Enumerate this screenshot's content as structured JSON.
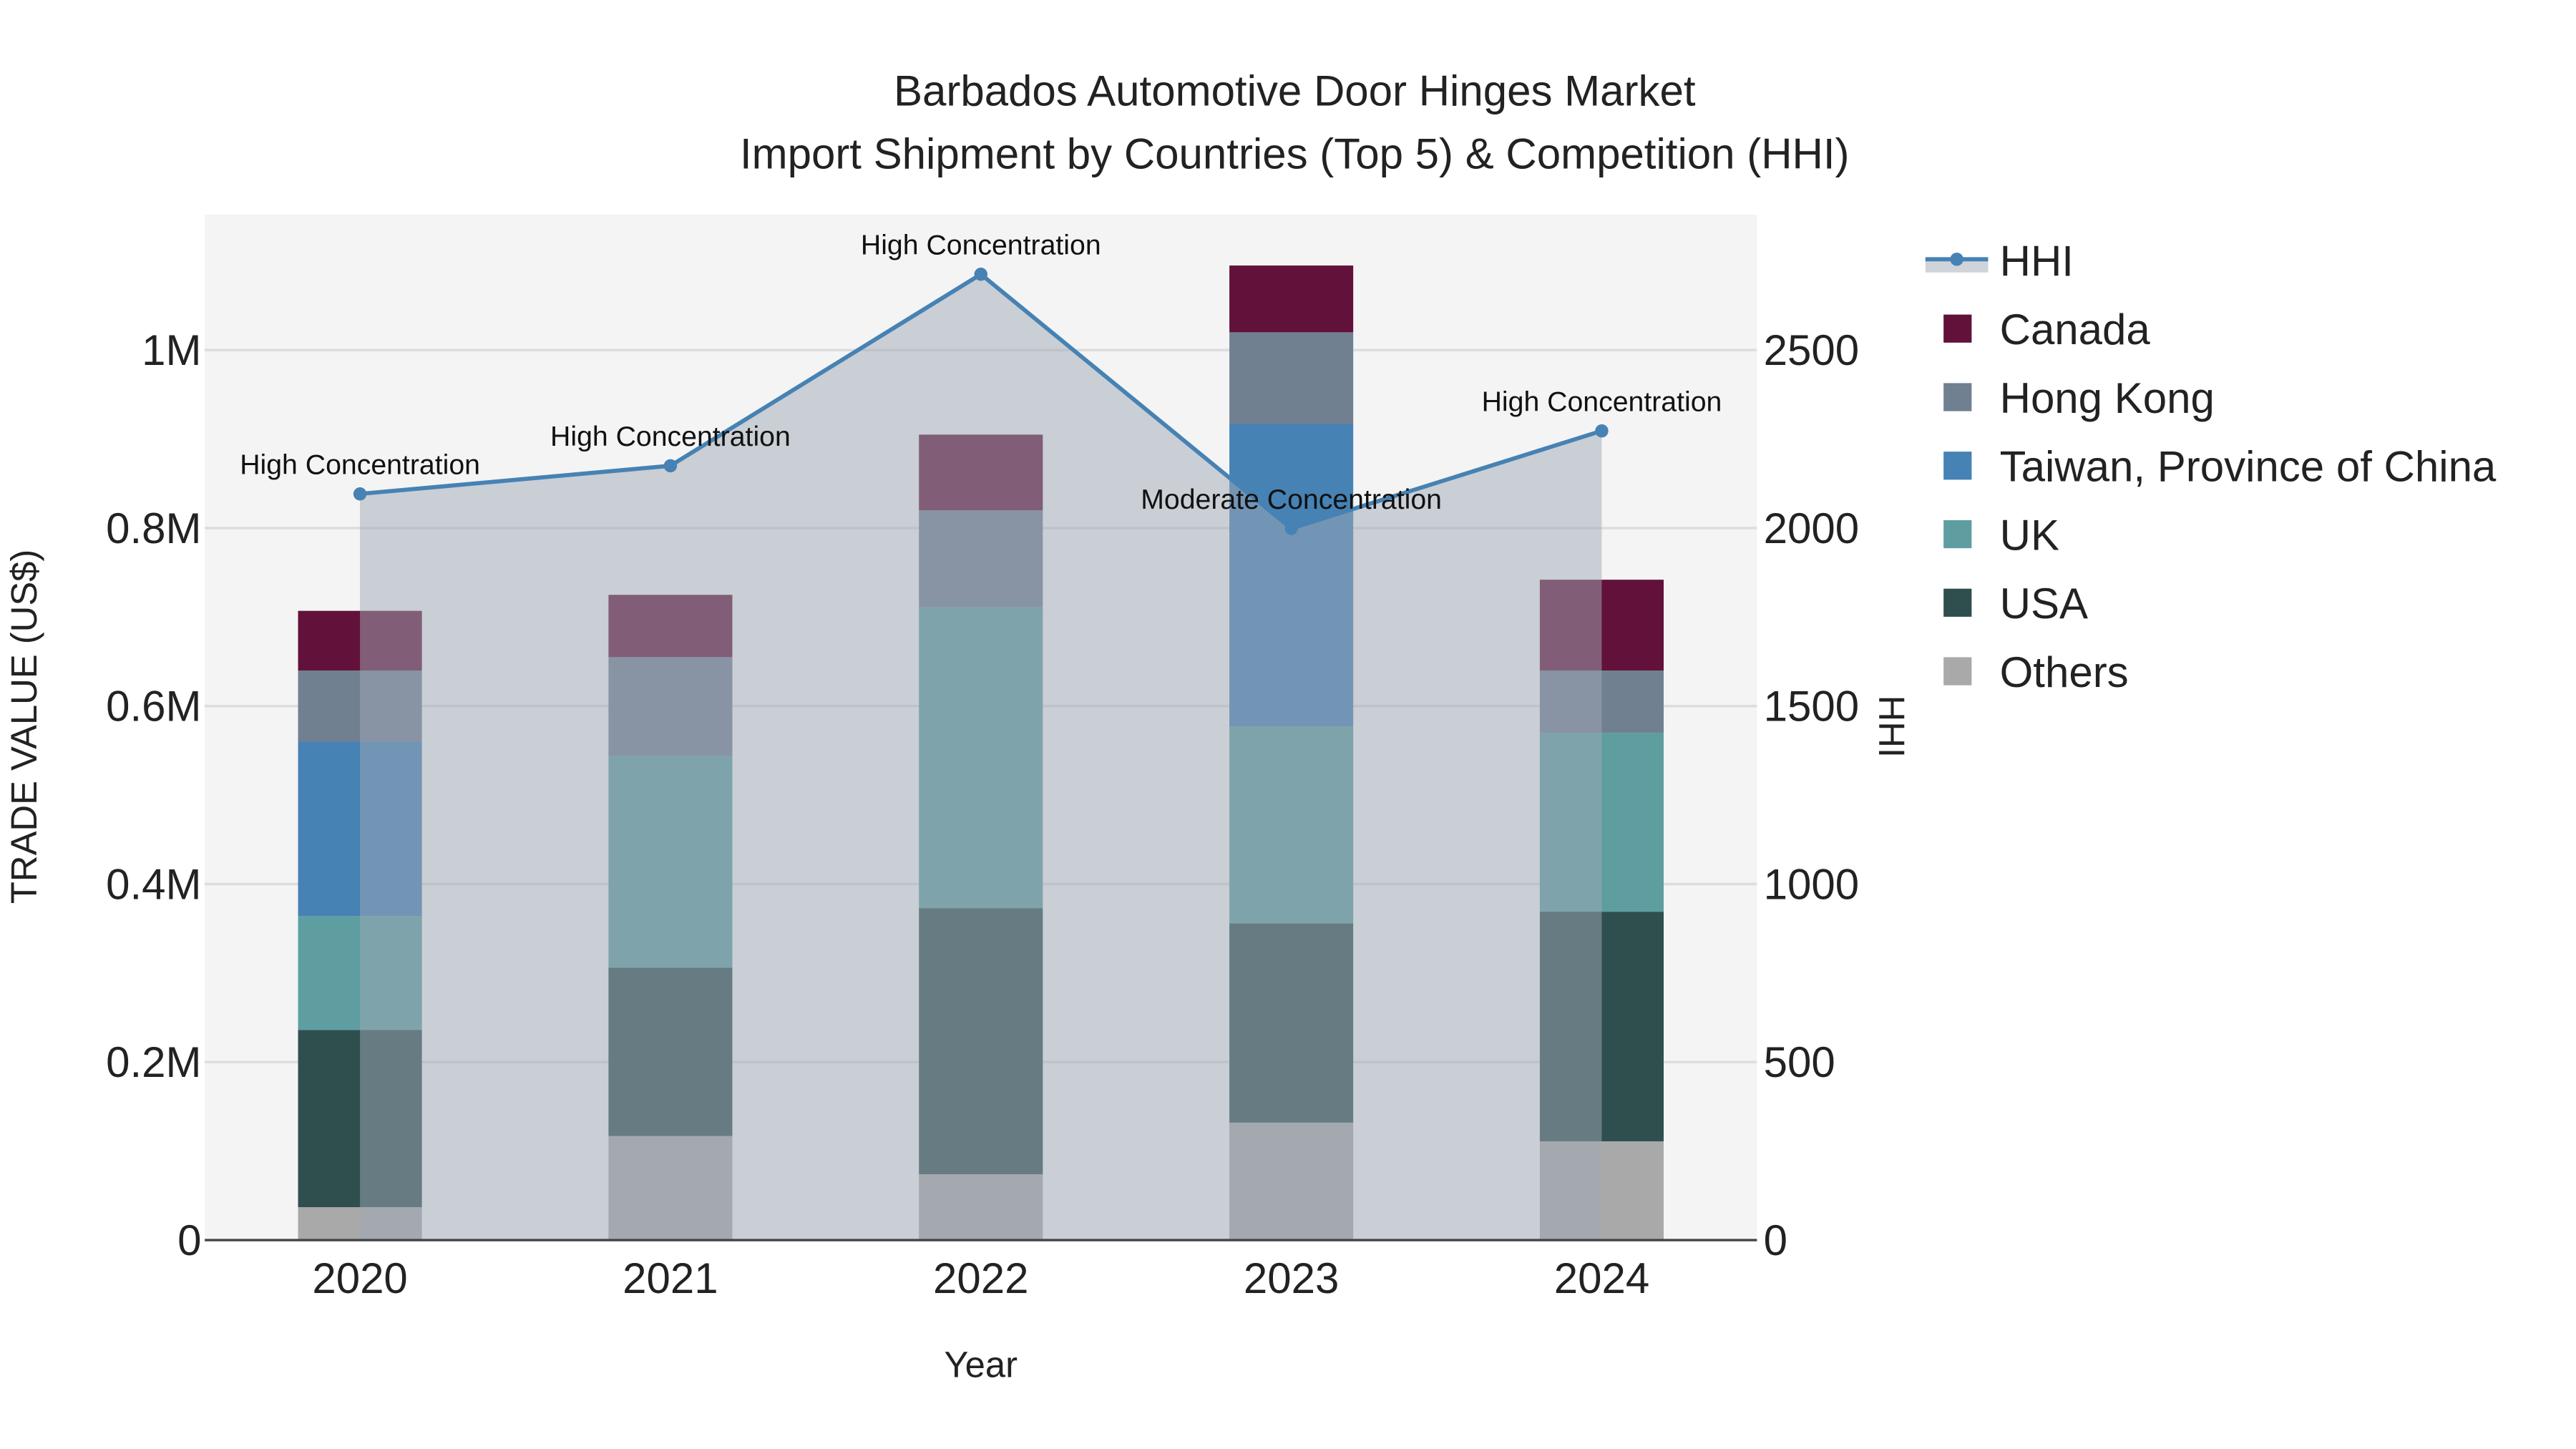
{
  "chart_data": {
    "type": "bar",
    "stacked": true,
    "title": "Barbados Automotive Door Hinges Market",
    "subtitle": "Import Shipment by Countries (Top 5) & Competition (HHI)",
    "xlabel": "Year",
    "ylabel": "TRADE VALUE (US$)",
    "y2label": "HHI",
    "categories": [
      "2020",
      "2021",
      "2022",
      "2023",
      "2024"
    ],
    "ylim": [
      0,
      1150000
    ],
    "y2lim": [
      0,
      2875
    ],
    "yticks": [
      0,
      200000,
      400000,
      600000,
      800000,
      1000000
    ],
    "yticklabels": [
      "0",
      "0.2M",
      "0.4M",
      "0.6M",
      "0.8M",
      "1M"
    ],
    "y2ticks": [
      0,
      500,
      1000,
      1500,
      2000,
      2500
    ],
    "y2ticklabels": [
      "0",
      "500",
      "1000",
      "1500",
      "2000",
      "2500"
    ],
    "grid": true,
    "legend_position": "right",
    "series": [
      {
        "name": "Others",
        "color": "#a9a9a9",
        "values": [
          37000,
          117000,
          74000,
          132000,
          111000
        ]
      },
      {
        "name": "USA",
        "color": "#2f4f4f",
        "values": [
          199000,
          189000,
          299000,
          224000,
          258000
        ]
      },
      {
        "name": "UK",
        "color": "#5f9ea0",
        "values": [
          128000,
          238000,
          338000,
          221000,
          201000
        ]
      },
      {
        "name": "Taiwan, Province of China",
        "color": "#4682b4",
        "values": [
          196000,
          0,
          0,
          340000,
          0
        ]
      },
      {
        "name": "Hong Kong",
        "color": "#708090",
        "values": [
          80000,
          111000,
          109000,
          103000,
          70000
        ]
      },
      {
        "name": "Canada",
        "color": "#62123a",
        "values": [
          67000,
          70000,
          85000,
          75000,
          102000
        ]
      }
    ],
    "hhi": {
      "name": "HHI",
      "color": "#4682b4",
      "values": [
        2096,
        2175,
        2713,
        1999,
        2273
      ],
      "annotations": [
        "High Concentration",
        "High Concentration",
        "High Concentration",
        "Moderate Concentration",
        "High Concentration"
      ]
    },
    "legend_order": [
      "HHI",
      "Canada",
      "Hong Kong",
      "Taiwan, Province of China",
      "UK",
      "USA",
      "Others"
    ]
  }
}
